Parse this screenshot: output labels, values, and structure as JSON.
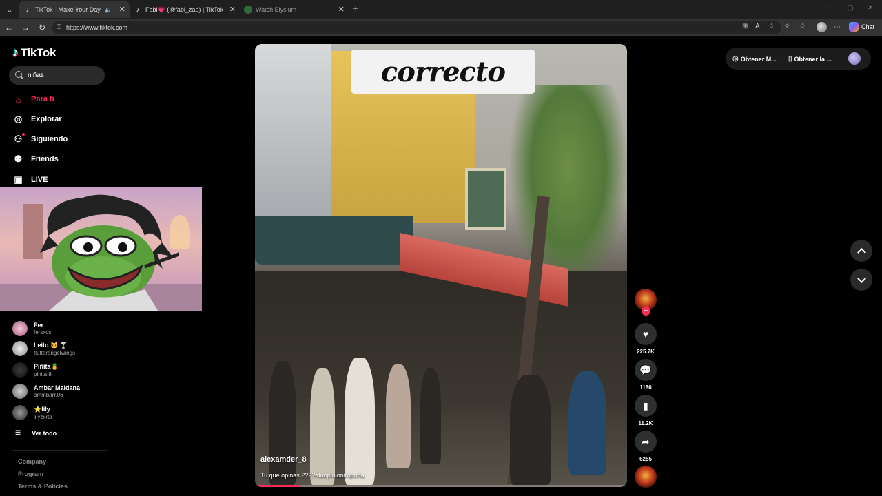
{
  "browser": {
    "tabs": [
      {
        "title": "TikTok - Make Your Day",
        "active": true
      },
      {
        "title": "Fabi💗 (@fabi_zap) | TikTok",
        "active": false
      },
      {
        "title": "Watch Elysium",
        "active": false
      }
    ],
    "url": "https://www.tiktok.com",
    "chat_label": "Chat"
  },
  "sidebar": {
    "logo": "TikTok",
    "search_value": "niñas",
    "nav": [
      {
        "label": "Para ti",
        "icon": "home-icon",
        "active": true
      },
      {
        "label": "Explorar",
        "icon": "compass-icon"
      },
      {
        "label": "Siguiendo",
        "icon": "following-icon"
      },
      {
        "label": "Friends",
        "icon": "friends-icon"
      },
      {
        "label": "LIVE",
        "icon": "live-icon"
      }
    ],
    "following": [
      {
        "name": "Fer",
        "username": "fersxcs_"
      },
      {
        "name": "Leito 🐱 🍸",
        "username": "flutterangelwings"
      },
      {
        "name": "Piñita🍍",
        "username": "pinita.8"
      },
      {
        "name": "Ambar Maidana",
        "username": "ammbarr.06"
      },
      {
        "name": "⭐lily",
        "username": "lilyzxrta"
      }
    ],
    "see_all": "Ver todo",
    "footer": [
      "Company",
      "Program",
      "Terms & Policies"
    ]
  },
  "video": {
    "overlay_text": "correcto",
    "author": "alexamder_8",
    "description": "Tu que opinas ????#tuopinionimporta",
    "progress": 0.12
  },
  "actions": {
    "likes": "225.7K",
    "comments": "1186",
    "saves": "11.2K",
    "shares": "6255"
  },
  "topbar": {
    "get_coins": "Obtener M...",
    "get_app": "Obtener la ..."
  },
  "colors": {
    "accent": "#fe2c55",
    "background": "#000000"
  }
}
